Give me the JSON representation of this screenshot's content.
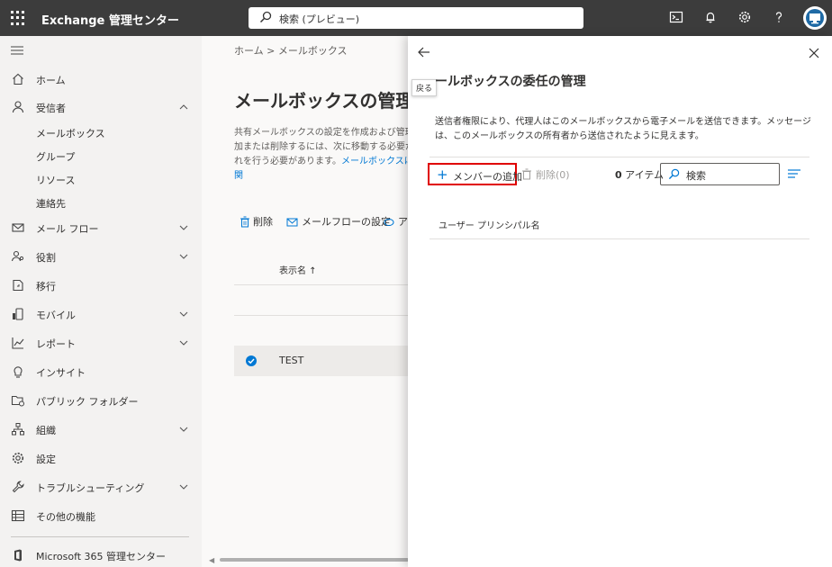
{
  "topbar": {
    "app_title": "Exchange 管理センター",
    "search_placeholder": "検索 (プレビュー)"
  },
  "nav": {
    "items": [
      {
        "label": "ホーム",
        "icon": "home-icon"
      },
      {
        "label": "受信者",
        "icon": "person-icon",
        "expanded": true
      },
      {
        "label": "メール フロー",
        "icon": "mail-icon"
      },
      {
        "label": "役割",
        "icon": "roles-icon"
      },
      {
        "label": "移行",
        "icon": "migration-icon"
      },
      {
        "label": "モバイル",
        "icon": "mobile-icon"
      },
      {
        "label": "レポート",
        "icon": "report-icon"
      },
      {
        "label": "インサイト",
        "icon": "insights-icon"
      },
      {
        "label": "パブリック フォルダー",
        "icon": "public-folder-icon"
      },
      {
        "label": "組織",
        "icon": "organization-icon"
      },
      {
        "label": "設定",
        "icon": "settings-icon"
      },
      {
        "label": "トラブルシューティング",
        "icon": "troubleshoot-icon"
      },
      {
        "label": "その他の機能",
        "icon": "table-icon"
      },
      {
        "label": "Microsoft 365 管理センター",
        "icon": "office-icon"
      }
    ],
    "sub_items": [
      "メールボックス",
      "グループ",
      "リソース",
      "連絡先"
    ]
  },
  "main": {
    "breadcrumb": "ホーム  >  メールボックス",
    "title": "メールボックスの管理",
    "description": "共有メールボックスの設定を作成および管理\n加または削除するには、次に移動する必要が\nれを行う必要があります。",
    "description_link": "メールボックスに関",
    "commands": {
      "delete": "削除",
      "mail_flow": "メールフローの設定",
      "more": "ア"
    },
    "column_display_name": "表示名 ↑",
    "row_name": "TEST"
  },
  "panel": {
    "back_tooltip": "戻る",
    "title": "ールボックスの委任の管理",
    "description": "送信者権限により、代理人はこのメールボックスから電子メールを送信できます。メッセージは、このメールボックスの所有者から送信されたように見えます。",
    "add_member": "メンバーの追加",
    "delete": "削除(0)",
    "item_count_number": "0",
    "item_count_label": "アイテム",
    "search_placeholder": "検索",
    "column_upn": "ユーザー プリンシパル名"
  },
  "colors": {
    "accent": "#0078d4",
    "topbar": "#3c3c3c",
    "highlight_border": "#e00000"
  }
}
